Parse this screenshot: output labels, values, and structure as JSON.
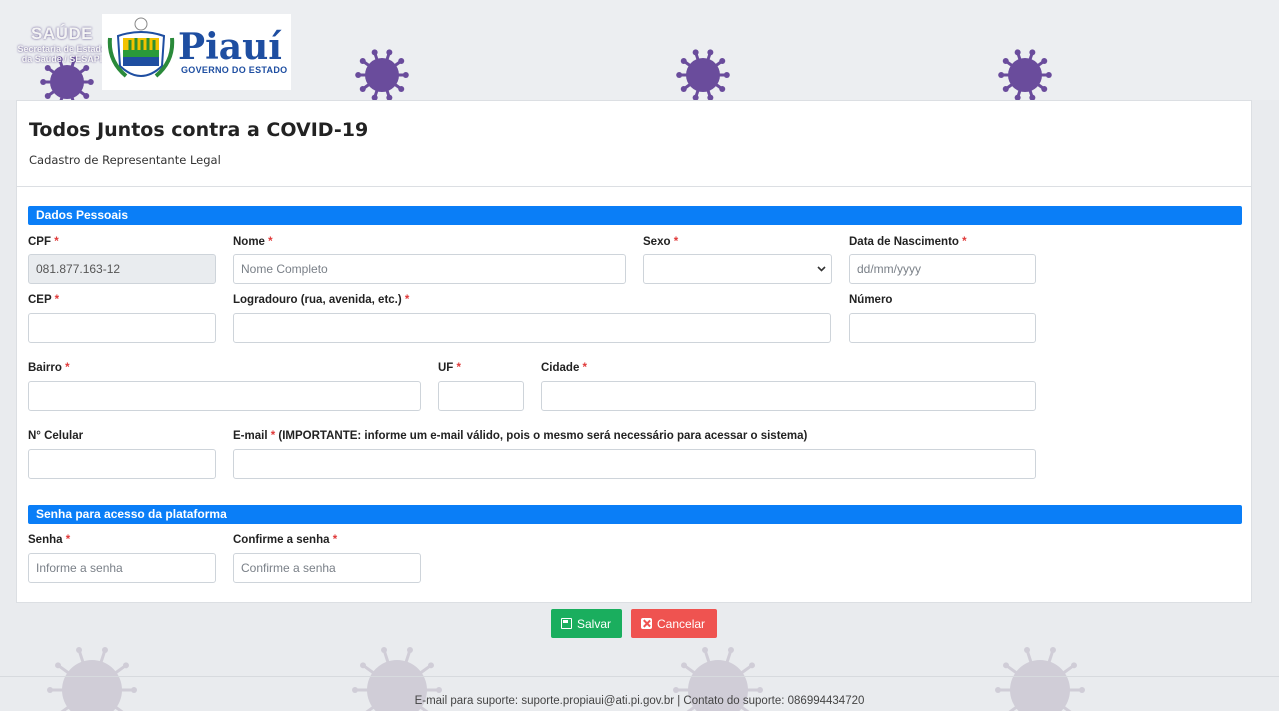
{
  "header": {
    "saude_logo": {
      "title": "SAÚDE",
      "subtitle": "Secretaria de Estado da Saúde / SESAPI"
    },
    "gov_logo": {
      "name": "Piauí",
      "subtitle": "GOVERNO DO ESTADO"
    }
  },
  "page": {
    "title": "Todos Juntos contra a COVID-19",
    "subtitle": "Cadastro de Representante Legal"
  },
  "sections": {
    "personal": "Dados Pessoais",
    "password": "Senha para acesso da plataforma"
  },
  "fields": {
    "cpf": {
      "label": "CPF",
      "required": "*",
      "value": "081.877.163-12"
    },
    "nome": {
      "label": "Nome",
      "required": "*",
      "placeholder": "Nome Completo",
      "value": ""
    },
    "sexo": {
      "label": "Sexo",
      "required": "*",
      "value": ""
    },
    "nascimento": {
      "label": "Data de Nascimento",
      "required": "*",
      "placeholder": "dd/mm/yyyy",
      "value": ""
    },
    "cep": {
      "label": "CEP",
      "required": "*",
      "value": ""
    },
    "logradouro": {
      "label": "Logradouro (rua, avenida, etc.)",
      "required": "*",
      "value": ""
    },
    "numero": {
      "label": "Número",
      "value": ""
    },
    "bairro": {
      "label": "Bairro",
      "required": "*",
      "value": ""
    },
    "uf": {
      "label": "UF",
      "required": "*",
      "value": ""
    },
    "cidade": {
      "label": "Cidade",
      "required": "*",
      "value": ""
    },
    "celular": {
      "label": "N° Celular",
      "value": ""
    },
    "email": {
      "label": "E-mail",
      "required": "*",
      "note": "(IMPORTANTE: informe um e-mail válido, pois o mesmo será necessário para acessar o sistema)",
      "value": ""
    },
    "senha": {
      "label": "Senha",
      "required": "*",
      "placeholder": "Informe a senha",
      "value": ""
    },
    "confirme": {
      "label": "Confirme a senha",
      "required": "*",
      "placeholder": "Confirme a senha",
      "value": ""
    }
  },
  "buttons": {
    "save": "Salvar",
    "cancel": "Cancelar"
  },
  "footer": {
    "text": "E-mail para suporte: suporte.propiaui@ati.pi.gov.br | Contato do suporte: 086994434720"
  },
  "colors": {
    "primary": "#0a7ef7",
    "save": "#1aae5e",
    "cancel": "#ef5350",
    "required": "#e03a3a",
    "virus": "#6a4c9c",
    "brand": "#1e4ea1"
  },
  "icons": {
    "save": "save-icon",
    "cancel": "close-square-icon",
    "select": "chevron-down-icon",
    "decor": "coronavirus-icon"
  }
}
